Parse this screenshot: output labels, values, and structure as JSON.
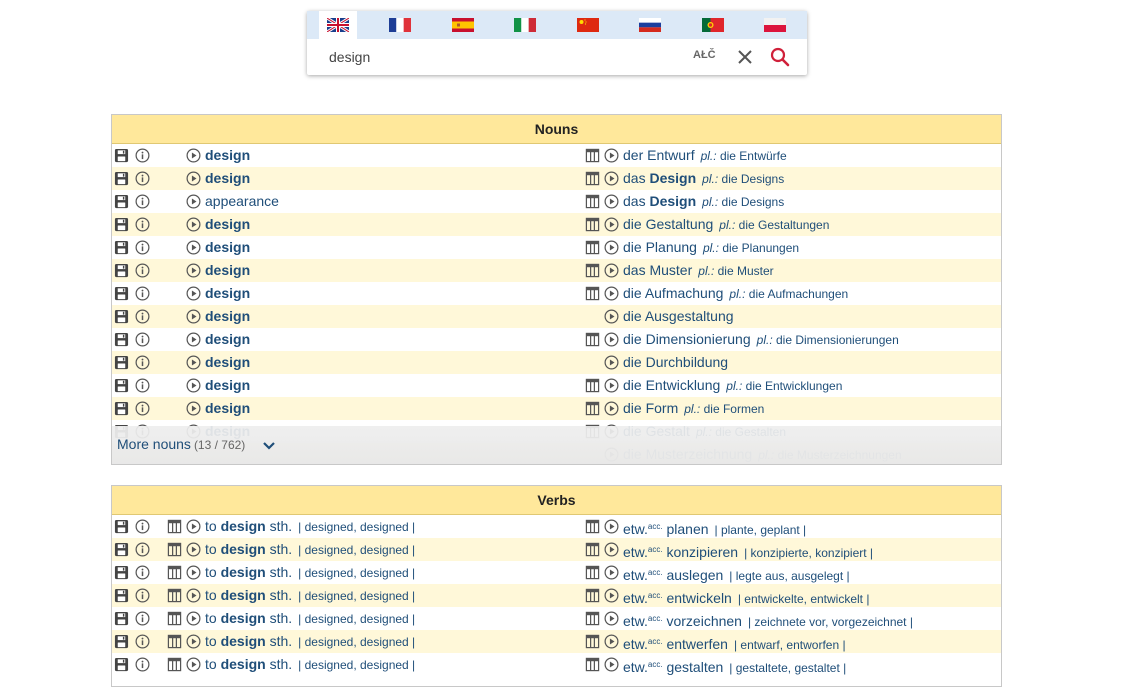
{
  "search": {
    "query": "design",
    "special_chars_label": "ΑŁČ",
    "languages": [
      {
        "code": "en-de",
        "flag": "uk-flag"
      },
      {
        "code": "fr-de",
        "flag": "france-flag"
      },
      {
        "code": "es-de",
        "flag": "spain-flag"
      },
      {
        "code": "it-de",
        "flag": "italy-flag"
      },
      {
        "code": "zh-de",
        "flag": "china-flag"
      },
      {
        "code": "ru-de",
        "flag": "russia-flag"
      },
      {
        "code": "pt-de",
        "flag": "portugal-flag"
      },
      {
        "code": "pl-de",
        "flag": "poland-flag"
      }
    ]
  },
  "nouns": {
    "title": "Nouns",
    "more_label": "More nouns",
    "more_count": "(13 / 762)",
    "rows": [
      {
        "en": "design",
        "en_bold": true,
        "de_art": "der",
        "de_word": "Entwurf",
        "de_bold": false,
        "pl_label": "pl.:",
        "plural": "die Entwürfe",
        "table_icon": true
      },
      {
        "en": "design",
        "en_bold": true,
        "de_art": "das",
        "de_word": "Design",
        "de_bold": true,
        "pl_label": "pl.:",
        "plural": "die Designs",
        "table_icon": true
      },
      {
        "en": "appearance",
        "en_bold": false,
        "de_art": "das",
        "de_word": "Design",
        "de_bold": true,
        "pl_label": "pl.:",
        "plural": "die Designs",
        "table_icon": true
      },
      {
        "en": "design",
        "en_bold": true,
        "de_art": "die",
        "de_word": "Gestaltung",
        "de_bold": false,
        "pl_label": "pl.:",
        "plural": "die Gestaltungen",
        "table_icon": true
      },
      {
        "en": "design",
        "en_bold": true,
        "de_art": "die",
        "de_word": "Planung",
        "de_bold": false,
        "pl_label": "pl.:",
        "plural": "die Planungen",
        "table_icon": true
      },
      {
        "en": "design",
        "en_bold": true,
        "de_art": "das",
        "de_word": "Muster",
        "de_bold": false,
        "pl_label": "pl.:",
        "plural": "die Muster",
        "table_icon": true
      },
      {
        "en": "design",
        "en_bold": true,
        "de_art": "die",
        "de_word": "Aufmachung",
        "de_bold": false,
        "pl_label": "pl.:",
        "plural": "die Aufmachungen",
        "table_icon": true
      },
      {
        "en": "design",
        "en_bold": true,
        "de_art": "die",
        "de_word": "Ausgestaltung",
        "de_bold": false,
        "pl_label": "",
        "plural": "",
        "table_icon": false
      },
      {
        "en": "design",
        "en_bold": true,
        "de_art": "die",
        "de_word": "Dimensionierung",
        "de_bold": false,
        "pl_label": "pl.:",
        "plural": "die Dimensionierungen",
        "table_icon": true
      },
      {
        "en": "design",
        "en_bold": true,
        "de_art": "die",
        "de_word": "Durchbildung",
        "de_bold": false,
        "pl_label": "",
        "plural": "",
        "table_icon": false
      },
      {
        "en": "design",
        "en_bold": true,
        "de_art": "die",
        "de_word": "Entwicklung",
        "de_bold": false,
        "pl_label": "pl.:",
        "plural": "die Entwicklungen",
        "table_icon": true
      },
      {
        "en": "design",
        "en_bold": true,
        "de_art": "die",
        "de_word": "Form",
        "de_bold": false,
        "pl_label": "pl.:",
        "plural": "die Formen",
        "table_icon": true
      },
      {
        "en": "design",
        "en_bold": true,
        "de_art": "die",
        "de_word": "Gestalt",
        "de_bold": false,
        "pl_label": "pl.:",
        "plural": "die Gestalten",
        "table_icon": true
      },
      {
        "en": "",
        "en_bold": false,
        "de_art": "die",
        "de_word": "Musterzeichnung",
        "de_bold": false,
        "pl_label": "pl.:",
        "plural": "die Musterzeichnungen",
        "table_icon": false
      }
    ]
  },
  "verbs": {
    "title": "Verbs",
    "rows": [
      {
        "to": "to",
        "verb": "design",
        "obj": "sth.",
        "en_forms": "| designed, designed |",
        "de_obj": "etw.",
        "de_case": "acc.",
        "de_verb": "planen",
        "de_forms": "| plante, geplant |"
      },
      {
        "to": "to",
        "verb": "design",
        "obj": "sth.",
        "en_forms": "| designed, designed |",
        "de_obj": "etw.",
        "de_case": "acc.",
        "de_verb": "konzipieren",
        "de_forms": "| konzipierte, konzipiert |"
      },
      {
        "to": "to",
        "verb": "design",
        "obj": "sth.",
        "en_forms": "| designed, designed |",
        "de_obj": "etw.",
        "de_case": "acc.",
        "de_verb": "auslegen",
        "de_forms": "| legte aus, ausgelegt |"
      },
      {
        "to": "to",
        "verb": "design",
        "obj": "sth.",
        "en_forms": "| designed, designed |",
        "de_obj": "etw.",
        "de_case": "acc.",
        "de_verb": "entwickeln",
        "de_forms": "| entwickelte, entwickelt |"
      },
      {
        "to": "to",
        "verb": "design",
        "obj": "sth.",
        "en_forms": "| designed, designed |",
        "de_obj": "etw.",
        "de_case": "acc.",
        "de_verb": "vorzeichnen",
        "de_forms": "| zeichnete vor, vorgezeichnet |"
      },
      {
        "to": "to",
        "verb": "design",
        "obj": "sth.",
        "en_forms": "| designed, designed |",
        "de_obj": "etw.",
        "de_case": "acc.",
        "de_verb": "entwerfen",
        "de_forms": "| entwarf, entworfen |"
      },
      {
        "to": "to",
        "verb": "design",
        "obj": "sth.",
        "en_forms": "| designed, designed |",
        "de_obj": "etw.",
        "de_case": "acc.",
        "de_verb": "gestalten",
        "de_forms": "| gestaltete, gestaltet |"
      }
    ]
  },
  "colors": {
    "header_bg": "#ffe89b",
    "row_alt_bg": "#fff8d9",
    "link_text": "#1f4e79",
    "search_accent": "#d0203a"
  }
}
